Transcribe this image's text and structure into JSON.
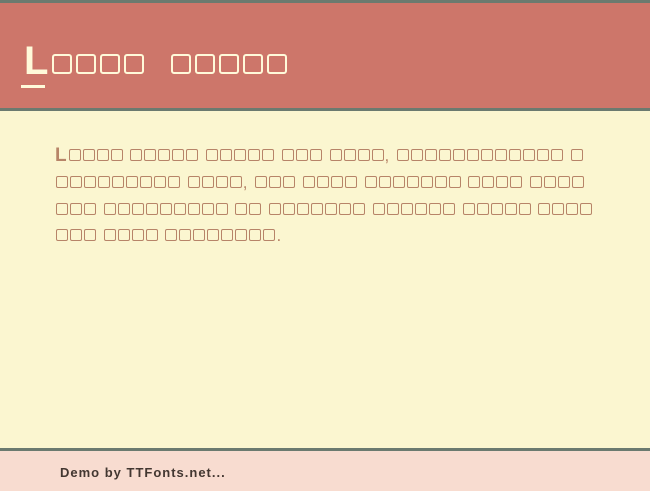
{
  "header": {
    "title_first": "L",
    "box_groups": [
      4,
      5
    ]
  },
  "body": {
    "first_letter": "L",
    "box_groups": [
      4,
      5,
      5,
      3,
      4
    ],
    "comma1": ",",
    "box_groups2": [
      12,
      10,
      4
    ],
    "comma2": ",",
    "box_groups3": [
      3,
      4,
      7,
      4,
      7,
      9,
      2,
      7,
      6,
      5,
      7,
      4,
      8
    ],
    "period": "."
  },
  "footer": {
    "text": "Demo by TTFonts.net..."
  }
}
